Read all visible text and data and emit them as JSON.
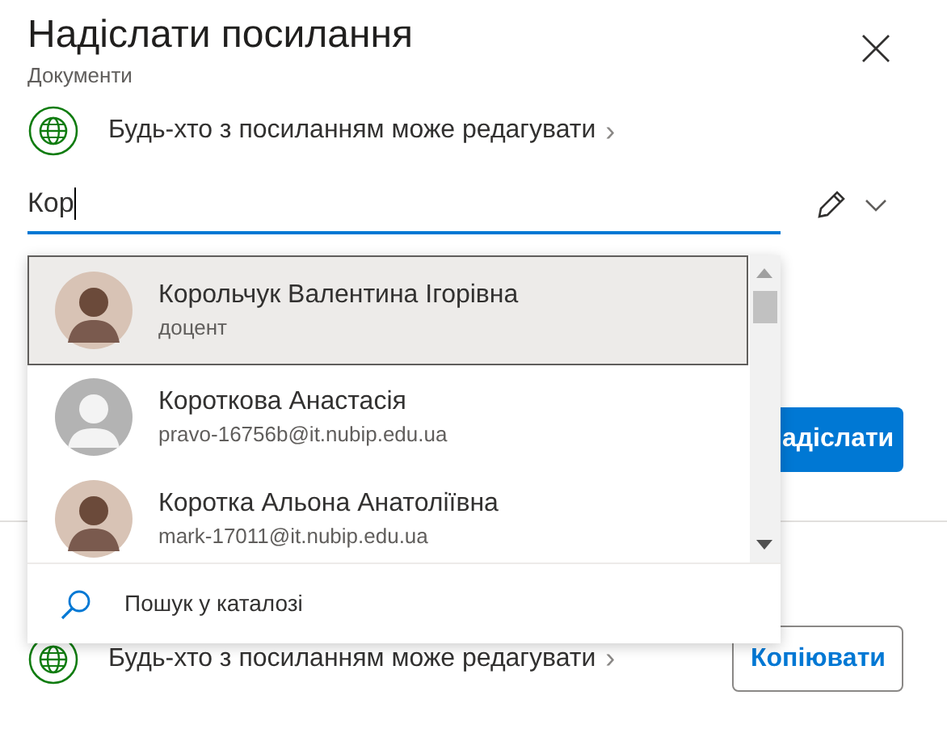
{
  "dialog": {
    "title": "Надіслати посилання",
    "subtitle": "Документи"
  },
  "link_setting": {
    "label": "Будь-хто з посиланням може редагувати",
    "chevron": "›"
  },
  "recipient_field": {
    "value": "Кор"
  },
  "suggestions": [
    {
      "name": "Корольчук Валентина Ігорівна",
      "detail": "доцент",
      "kind": "photo",
      "selected": true
    },
    {
      "name": "Короткова Анастасія",
      "detail": "pravo-16756b@it.nubip.edu.ua",
      "kind": "placeholder",
      "selected": false
    },
    {
      "name": "Коротка Альона Анатоліївна",
      "detail": "mark-17011@it.nubip.edu.ua",
      "kind": "photo",
      "selected": false
    }
  ],
  "directory_search": {
    "label": "Пошук у каталозі"
  },
  "send_button": {
    "label": "адіслати"
  },
  "copy_link": {
    "label": "Будь-хто з посиланням може редагувати",
    "chevron": "›",
    "button": "Копіювати"
  }
}
